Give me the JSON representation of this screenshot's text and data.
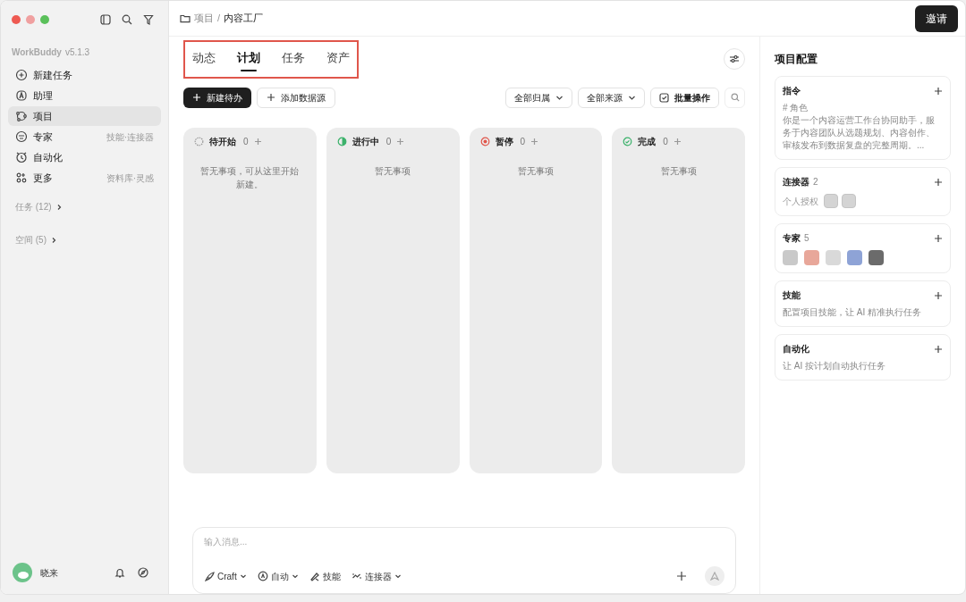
{
  "sidebar": {
    "app_name": "WorkBuddy",
    "version": "v5.1.3",
    "items": [
      {
        "label": "新建任务",
        "selected": false
      },
      {
        "label": "助理",
        "selected": false
      },
      {
        "label": "项目",
        "selected": true
      },
      {
        "label": "专家",
        "hint": "技能·连接器",
        "selected": false
      },
      {
        "label": "自动化",
        "selected": false
      },
      {
        "label": "更多",
        "hint": "资料库·灵感",
        "selected": false
      }
    ],
    "sections": [
      {
        "label": "任务 (12)"
      },
      {
        "label": "空间 (5)"
      }
    ],
    "user": {
      "name": "晓来"
    }
  },
  "breadcrumb": [
    "项目",
    "内容工厂"
  ],
  "breadcrumb_separator": "/",
  "invite_button": "邀请",
  "tabs": [
    {
      "label": "动态",
      "selected": false
    },
    {
      "label": "计划",
      "selected": true
    },
    {
      "label": "任务",
      "selected": false
    },
    {
      "label": "资产",
      "selected": false
    }
  ],
  "toolbar": {
    "primary": "新建待办",
    "secondary": "添加数据源",
    "filters": [
      "全部归属",
      "全部来源"
    ],
    "batch": "批量操作"
  },
  "columns": [
    {
      "title": "待开始",
      "count": "0",
      "kind": "todo",
      "empty": "暂无事项，可从这里开始新建。"
    },
    {
      "title": "进行中",
      "count": "0",
      "kind": "doing",
      "empty": "暂无事项"
    },
    {
      "title": "暂停",
      "count": "0",
      "kind": "paused",
      "empty": "暂无事项"
    },
    {
      "title": "完成",
      "count": "0",
      "kind": "done",
      "empty": "暂无事项"
    }
  ],
  "composer": {
    "placeholder": "输入消息...",
    "tools": [
      {
        "label": "Craft",
        "dropdown": true
      },
      {
        "label": "自动",
        "dropdown": true
      },
      {
        "label": "技能",
        "dropdown": false
      },
      {
        "label": "连接器",
        "dropdown": true
      }
    ]
  },
  "config": {
    "title": "项目配置",
    "cards": [
      {
        "kind": "text",
        "title": "指令",
        "lines": [
          "# 角色",
          "你是一个内容运营工作台协同助手，服务于内容团队从选题规划、内容创作、审核发布到数据复盘的完整周期。..."
        ]
      },
      {
        "kind": "connectors",
        "title": "连接器",
        "count": "2",
        "label": "个人授权"
      },
      {
        "kind": "experts",
        "title": "专家",
        "count": "5"
      },
      {
        "kind": "text",
        "title": "技能",
        "lines": [
          "配置项目技能，让 AI 精准执行任务"
        ]
      },
      {
        "kind": "text",
        "title": "自动化",
        "lines": [
          "让 AI 按计划自动执行任务"
        ]
      }
    ]
  }
}
